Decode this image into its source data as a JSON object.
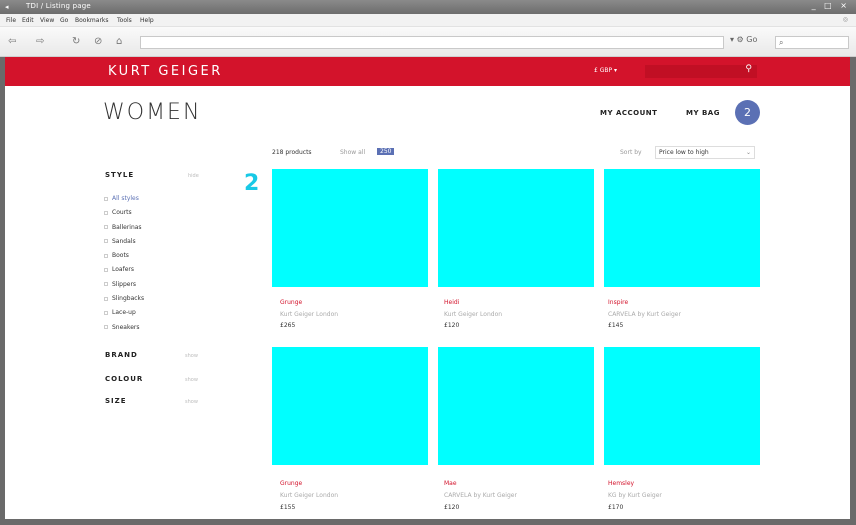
{
  "window": {
    "title": "TDI / Listing page",
    "controls": "_ □ ×"
  },
  "menubar": {
    "items": [
      "File",
      "Edit",
      "View",
      "Go",
      "Bookmarks",
      "Tools",
      "Help"
    ]
  },
  "toolbar": {
    "url": "",
    "go_label": "Go",
    "search_placeholder": ""
  },
  "site": {
    "brand": "KURT GEIGER",
    "currency": "£ GBP",
    "search_icon": "magnifier-icon"
  },
  "page": {
    "title": "WOMEN",
    "account_label": "MY ACCOUNT",
    "bag_label": "MY BAG",
    "bag_count": "2",
    "results": "218 products",
    "view_all": "Show all",
    "view_all_badge": "250",
    "sort_label": "Sort by",
    "sort_value": "Price low to high",
    "step_marker": "2"
  },
  "filters": {
    "style": {
      "title": "STYLE",
      "toggle": "hide",
      "items": [
        "All styles",
        "Courts",
        "Ballerinas",
        "Sandals",
        "Boots",
        "Loafers",
        "Slippers",
        "Slingbacks",
        "Lace-up",
        "Sneakers"
      ]
    },
    "brand": {
      "title": "BRAND",
      "toggle": "show"
    },
    "colour": {
      "title": "COLOUR",
      "toggle": "show"
    },
    "size": {
      "title": "SIZE",
      "toggle": "show"
    }
  },
  "products": [
    {
      "name": "Grunge",
      "brand": "Kurt Geiger London",
      "price": "£265"
    },
    {
      "name": "Heidi",
      "brand": "Kurt Geiger London",
      "price": "£120"
    },
    {
      "name": "Inspire",
      "brand": "CARVELA by Kurt Geiger",
      "price": "£145"
    },
    {
      "name": "Grunge",
      "brand": "Kurt Geiger London",
      "price": "£155"
    },
    {
      "name": "Mae",
      "brand": "CARVELA by Kurt Geiger",
      "price": "£120"
    },
    {
      "name": "Hemsley",
      "brand": "KG by Kurt Geiger",
      "price": "£170"
    }
  ],
  "colors": {
    "brand_red": "#d3132b",
    "accent_blue": "#5b70b4",
    "placeholder_image": "#00ffff",
    "step_marker": "#18c9e6"
  }
}
